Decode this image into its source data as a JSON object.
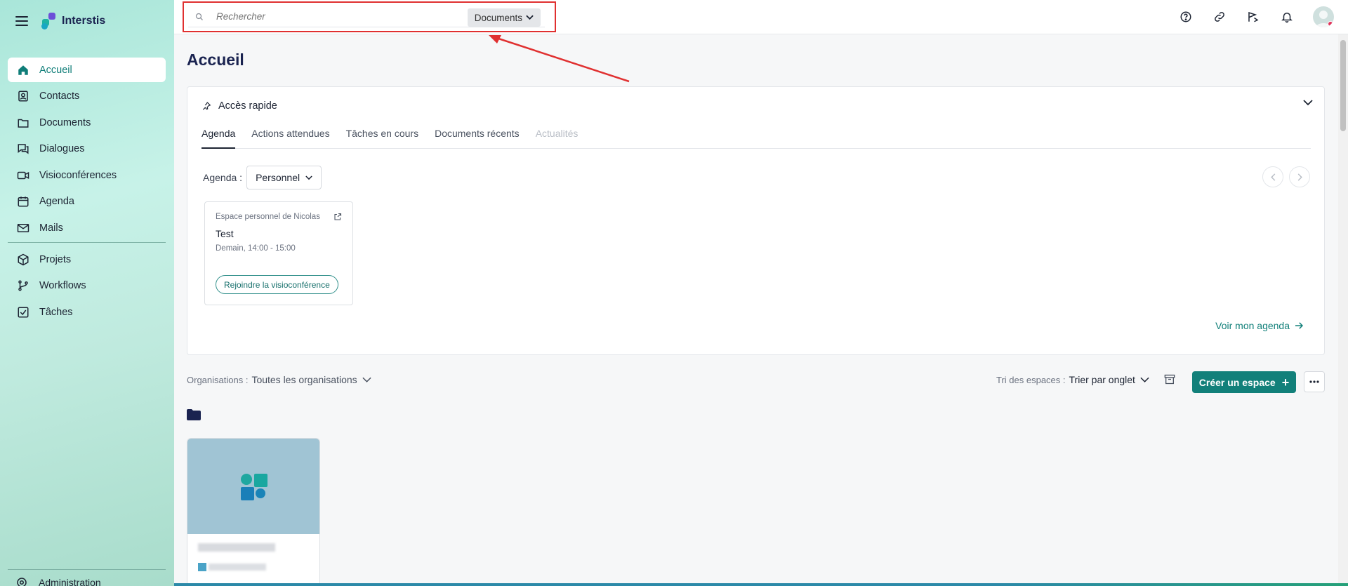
{
  "app": {
    "name": "Interstis",
    "accent": "#12807a"
  },
  "sidebar": {
    "items": [
      {
        "label": "Accueil",
        "icon": "home-icon",
        "active": true
      },
      {
        "label": "Contacts",
        "icon": "contacts-icon"
      },
      {
        "label": "Documents",
        "icon": "folder-icon"
      },
      {
        "label": "Dialogues",
        "icon": "chat-icon"
      },
      {
        "label": "Visioconférences",
        "icon": "video-icon"
      },
      {
        "label": "Agenda",
        "icon": "calendar-icon"
      },
      {
        "label": "Mails",
        "icon": "mail-icon"
      },
      {
        "label": "Projets",
        "icon": "cube-icon"
      },
      {
        "label": "Workflows",
        "icon": "branch-icon"
      },
      {
        "label": "Tâches",
        "icon": "checkbox-icon"
      }
    ],
    "admin_label": "Administration"
  },
  "search": {
    "placeholder": "Rechercher",
    "scope": "Documents"
  },
  "page": {
    "title": "Accueil"
  },
  "quick_access": {
    "title": "Accès rapide",
    "tabs": [
      "Agenda",
      "Actions attendues",
      "Tâches en cours",
      "Documents récents",
      "Actualités"
    ],
    "agenda_label": "Agenda :",
    "agenda_select": "Personnel",
    "event": {
      "space": "Espace personnel de Nicolas",
      "title": "Test",
      "time": "Demain, 14:00 - 15:00",
      "join_label": "Rejoindre la visioconférence"
    },
    "see_agenda": "Voir mon agenda"
  },
  "filters": {
    "org_label": "Organisations :",
    "org_value": "Toutes les organisations",
    "sort_label": "Tri des espaces :",
    "sort_value": "Trier par onglet",
    "create_label": "Créer un espace"
  }
}
